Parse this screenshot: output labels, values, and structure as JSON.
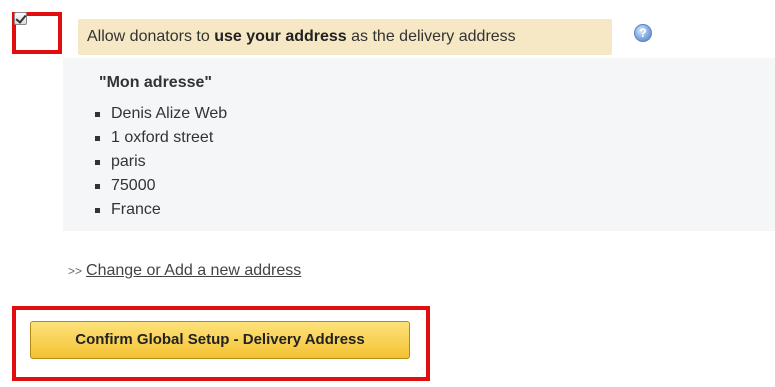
{
  "delivery_option": {
    "checked": true,
    "label_prefix": "Allow donators to ",
    "label_bold": "use your address",
    "label_suffix": " as the delivery address",
    "help_icon": "help-icon"
  },
  "address": {
    "title": "\"Mon adresse\"",
    "lines": [
      "Denis Alize Web",
      "1 oxford street",
      "paris",
      "75000",
      "France"
    ]
  },
  "change_address": {
    "prefix": ">>",
    "link_text": "Change or Add a new address"
  },
  "confirm": {
    "label": "Confirm Global Setup - Delivery Address"
  },
  "colors": {
    "highlight_frame": "#e30d10",
    "option_background": "#f6e7c5",
    "panel_background": "#f5f6f8",
    "button_background": "#f4c232"
  }
}
